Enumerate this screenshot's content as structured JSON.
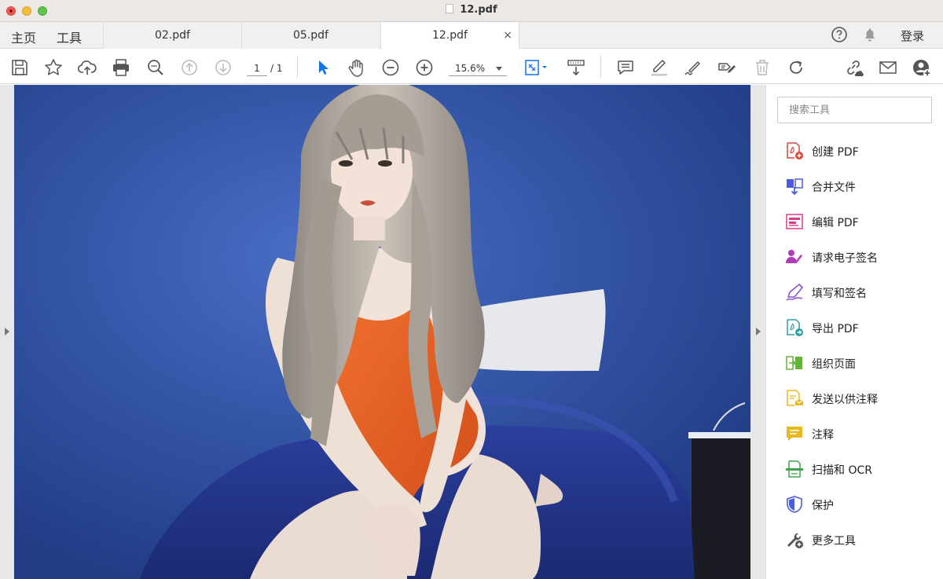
{
  "window": {
    "title": "12.pdf"
  },
  "nav": {
    "home": "主页",
    "tools": "工具"
  },
  "tabs": [
    {
      "label": "02.pdf"
    },
    {
      "label": "05.pdf"
    },
    {
      "label": "12.pdf",
      "active": true,
      "close": "×"
    }
  ],
  "header_right": {
    "login": "登录",
    "icons": [
      "help-icon",
      "bell-icon"
    ]
  },
  "toolbar": {
    "page_current": "1",
    "page_total": "/ 1",
    "zoom": "15.6%"
  },
  "search": {
    "placeholder": "搜索工具"
  },
  "tools_panel": [
    {
      "label": "创建 PDF",
      "icon": "create-pdf-icon",
      "color": "#e0453a"
    },
    {
      "label": "合并文件",
      "icon": "combine-files-icon",
      "color": "#4a5be0"
    },
    {
      "label": "编辑 PDF",
      "icon": "edit-pdf-icon",
      "color": "#d83d8c"
    },
    {
      "label": "请求电子签名",
      "icon": "request-signature-icon",
      "color": "#b03bb8"
    },
    {
      "label": "填写和签名",
      "icon": "fill-sign-icon",
      "color": "#8a4fd6"
    },
    {
      "label": "导出 PDF",
      "icon": "export-pdf-icon",
      "color": "#2e9e9a"
    },
    {
      "label": "组织页面",
      "icon": "organize-pages-icon",
      "color": "#62b33a"
    },
    {
      "label": "发送以供注释",
      "icon": "send-comments-icon",
      "color": "#e8b820"
    },
    {
      "label": "注释",
      "icon": "comment-icon",
      "color": "#e8b820"
    },
    {
      "label": "扫描和 OCR",
      "icon": "scan-ocr-icon",
      "color": "#3ea34a"
    },
    {
      "label": "保护",
      "icon": "protect-icon",
      "color": "#4a5be0"
    },
    {
      "label": "更多工具",
      "icon": "more-tools-icon",
      "color": "#555555"
    }
  ],
  "colors": {
    "accent": "#1473e6",
    "canvas_bg": "#2e4fa6"
  }
}
